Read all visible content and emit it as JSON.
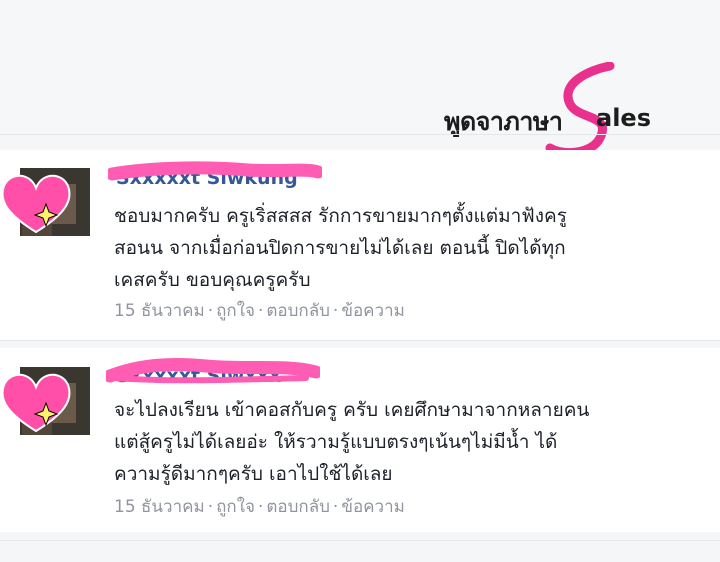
{
  "logo": {
    "text_left": "พูดจาภาษา",
    "text_right": "ales",
    "s_color": "#e8308c"
  },
  "comments": [
    {
      "name": "Sxxxxxt Siwkung",
      "lines": [
        "ชอบมากครับ ครูเริ่สสสส รักการขายมากๆตั้งแต่มาฟังครู",
        "สอนน จากเมื่อก่อนปิดการขายไม่ได้เลย  ตอนนี้ ปิดได้ทุก",
        "เคสครับ ขอบคุณครูครับ"
      ],
      "date": "15 ธันวาคม",
      "like": "ถูกใจ",
      "reply": "ตอบกลับ",
      "message": "ข้อความ"
    },
    {
      "name": "Sxxxxxt Siwxxx",
      "lines": [
        "จะไปลงเรียน เข้าคอสกับครู ครับ เคยศึกษามาจากหลายคน",
        "แต่สู้ครูไม่ได้เลยอ่ะ ให้รวามรู้แบบตรงๆเน้นๆไม่มีน้ำ ได้",
        "ความรู้ดีมากๆครับ เอาไปใช้ได้เลย"
      ],
      "date": "15 ธันวาคม",
      "like": "ถูกใจ",
      "reply": "ตอบกลับ",
      "message": "ข้อความ"
    }
  ],
  "colors": {
    "heart": "#ff4fa8",
    "scribble": "#ff5cb4",
    "link": "#365899",
    "meta": "#90949c"
  }
}
